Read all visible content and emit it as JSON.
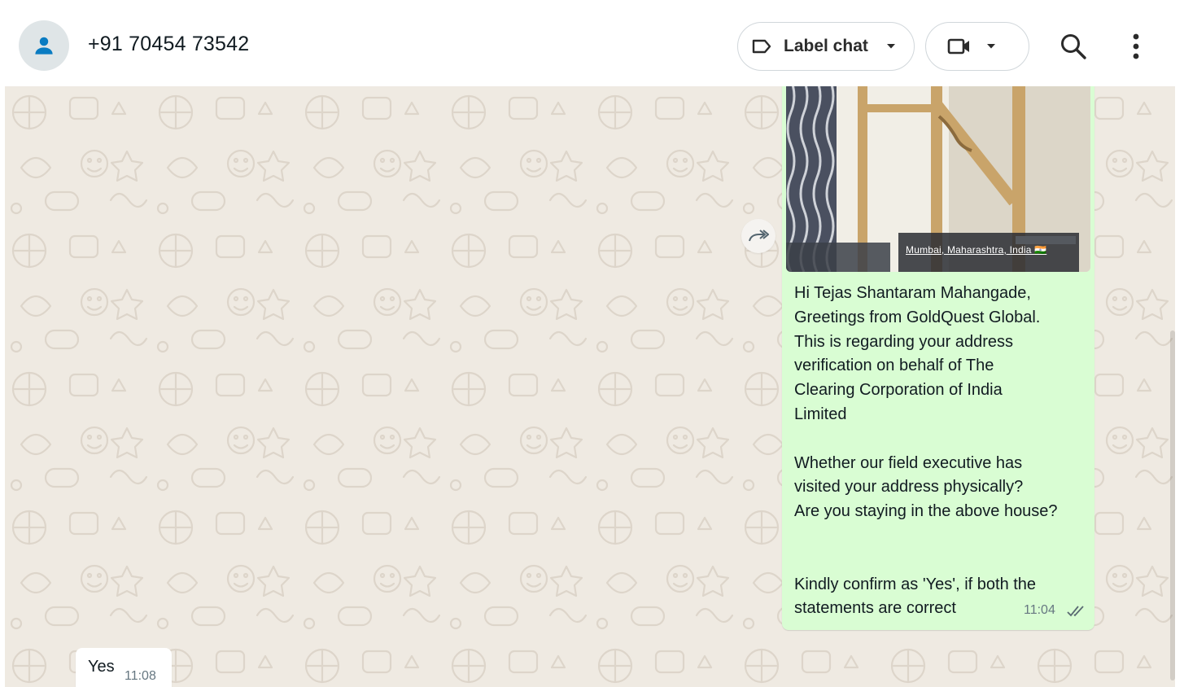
{
  "header": {
    "contact_name": "+91 70454 73542",
    "label_chat": "Label chat",
    "icons": [
      "person-icon",
      "label-icon",
      "chevron-down-icon",
      "video-call-icon",
      "search-icon",
      "more-vertical-icon"
    ]
  },
  "messages": [
    {
      "direction": "outgoing",
      "has_image": true,
      "image_caption": "Mumbai, Maharashtra, India 🇮🇳",
      "text": "Hi Tejas Shantaram Mahangade,\nGreetings from GoldQuest Global.\nThis is regarding your address\nverification on behalf of The\nClearing Corporation of India\nLimited\n\nWhether our field executive has\nvisited your address physically?\nAre you staying in the above house?\n\n\nKindly confirm as 'Yes', if both the\nstatements are correct",
      "time": "11:04",
      "status": "read"
    },
    {
      "direction": "incoming",
      "text": "Yes",
      "time": "11:08"
    }
  ],
  "colors": {
    "chat_background": "#efeae2",
    "outgoing_bubble": "#d9fdd3",
    "incoming_bubble": "#ffffff",
    "avatar_icon": "#0a7cc2"
  }
}
